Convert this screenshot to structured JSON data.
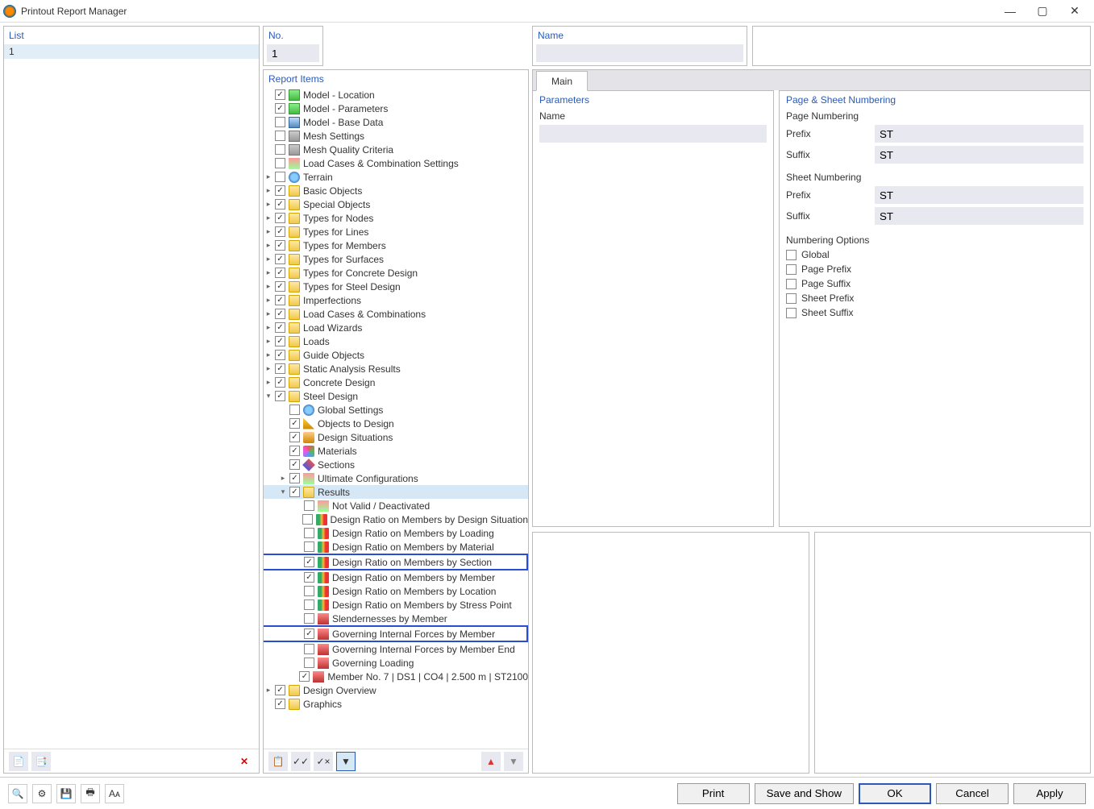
{
  "window": {
    "title": "Printout Report Manager"
  },
  "list": {
    "header": "List",
    "items": [
      "1"
    ]
  },
  "no": {
    "label": "No.",
    "value": "1"
  },
  "name": {
    "label": "Name",
    "value": ""
  },
  "report_header": "Report Items",
  "tree": [
    {
      "chev": "",
      "ind": 0,
      "chk": true,
      "icon": "ico-model",
      "label": "Model - Location"
    },
    {
      "chev": "",
      "ind": 0,
      "chk": true,
      "icon": "ico-model",
      "label": "Model - Parameters"
    },
    {
      "chev": "",
      "ind": 0,
      "chk": false,
      "icon": "ico-model2",
      "label": "Model - Base Data"
    },
    {
      "chev": "",
      "ind": 0,
      "chk": false,
      "icon": "ico-mesh",
      "label": "Mesh Settings"
    },
    {
      "chev": "",
      "ind": 0,
      "chk": false,
      "icon": "ico-mesh",
      "label": "Mesh Quality Criteria"
    },
    {
      "chev": "",
      "ind": 0,
      "chk": false,
      "icon": "ico-chart",
      "label": "Load Cases & Combination Settings"
    },
    {
      "chev": ">",
      "ind": 0,
      "chk": false,
      "icon": "ico-globe",
      "label": "Terrain"
    },
    {
      "chev": ">",
      "ind": 0,
      "chk": true,
      "icon": "ico-folder",
      "label": "Basic Objects"
    },
    {
      "chev": ">",
      "ind": 0,
      "chk": true,
      "icon": "ico-folder",
      "label": "Special Objects"
    },
    {
      "chev": ">",
      "ind": 0,
      "chk": true,
      "icon": "ico-folder",
      "label": "Types for Nodes"
    },
    {
      "chev": ">",
      "ind": 0,
      "chk": true,
      "icon": "ico-folder",
      "label": "Types for Lines"
    },
    {
      "chev": ">",
      "ind": 0,
      "chk": true,
      "icon": "ico-folder",
      "label": "Types for Members"
    },
    {
      "chev": ">",
      "ind": 0,
      "chk": true,
      "icon": "ico-folder",
      "label": "Types for Surfaces"
    },
    {
      "chev": ">",
      "ind": 0,
      "chk": true,
      "icon": "ico-folder",
      "label": "Types for Concrete Design"
    },
    {
      "chev": ">",
      "ind": 0,
      "chk": true,
      "icon": "ico-folder",
      "label": "Types for Steel Design"
    },
    {
      "chev": ">",
      "ind": 0,
      "chk": true,
      "icon": "ico-folder",
      "label": "Imperfections"
    },
    {
      "chev": ">",
      "ind": 0,
      "chk": true,
      "icon": "ico-folder",
      "label": "Load Cases & Combinations"
    },
    {
      "chev": ">",
      "ind": 0,
      "chk": true,
      "icon": "ico-folder",
      "label": "Load Wizards"
    },
    {
      "chev": ">",
      "ind": 0,
      "chk": true,
      "icon": "ico-folder",
      "label": "Loads"
    },
    {
      "chev": ">",
      "ind": 0,
      "chk": true,
      "icon": "ico-folder",
      "label": "Guide Objects"
    },
    {
      "chev": ">",
      "ind": 0,
      "chk": true,
      "icon": "ico-folder",
      "label": "Static Analysis Results"
    },
    {
      "chev": ">",
      "ind": 0,
      "chk": true,
      "icon": "ico-folder",
      "label": "Concrete Design"
    },
    {
      "chev": "v",
      "ind": 0,
      "chk": true,
      "icon": "ico-folder",
      "label": "Steel Design"
    },
    {
      "chev": "",
      "ind": 1,
      "chk": false,
      "icon": "ico-globe",
      "label": "Global Settings"
    },
    {
      "chev": "",
      "ind": 1,
      "chk": true,
      "icon": "ico-obj",
      "label": "Objects to Design"
    },
    {
      "chev": "",
      "ind": 1,
      "chk": true,
      "icon": "ico-wizard",
      "label": "Design Situations"
    },
    {
      "chev": "",
      "ind": 1,
      "chk": true,
      "icon": "ico-mat",
      "label": "Materials"
    },
    {
      "chev": "",
      "ind": 1,
      "chk": true,
      "icon": "ico-sec",
      "label": "Sections"
    },
    {
      "chev": ">",
      "ind": 1,
      "chk": true,
      "icon": "ico-chart",
      "label": "Ultimate Configurations"
    },
    {
      "chev": "v",
      "ind": 1,
      "chk": true,
      "icon": "ico-folder",
      "label": "Results",
      "sel": true
    },
    {
      "chev": "",
      "ind": 2,
      "chk": false,
      "icon": "ico-chart",
      "label": "Not Valid / Deactivated"
    },
    {
      "chev": "",
      "ind": 2,
      "chk": false,
      "icon": "ico-ratio",
      "label": "Design Ratio on Members by Design Situation"
    },
    {
      "chev": "",
      "ind": 2,
      "chk": false,
      "icon": "ico-ratio",
      "label": "Design Ratio on Members by Loading"
    },
    {
      "chev": "",
      "ind": 2,
      "chk": false,
      "icon": "ico-ratio",
      "label": "Design Ratio on Members by Material"
    },
    {
      "chev": "",
      "ind": 2,
      "chk": true,
      "icon": "ico-ratio",
      "label": "Design Ratio on Members by Section",
      "hl": true
    },
    {
      "chev": "",
      "ind": 2,
      "chk": true,
      "icon": "ico-ratio",
      "label": "Design Ratio on Members by Member"
    },
    {
      "chev": "",
      "ind": 2,
      "chk": false,
      "icon": "ico-ratio",
      "label": "Design Ratio on Members by Location"
    },
    {
      "chev": "",
      "ind": 2,
      "chk": false,
      "icon": "ico-ratio",
      "label": "Design Ratio on Members by Stress Point"
    },
    {
      "chev": "",
      "ind": 2,
      "chk": false,
      "icon": "ico-force",
      "label": "Slendernesses by Member"
    },
    {
      "chev": "",
      "ind": 2,
      "chk": true,
      "icon": "ico-force",
      "label": "Governing Internal Forces by Member",
      "hl": true
    },
    {
      "chev": "",
      "ind": 2,
      "chk": false,
      "icon": "ico-force",
      "label": "Governing Internal Forces by Member End"
    },
    {
      "chev": "",
      "ind": 2,
      "chk": false,
      "icon": "ico-force",
      "label": "Governing Loading"
    },
    {
      "chev": "",
      "ind": 2,
      "chk": true,
      "icon": "ico-force",
      "label": "Member No. 7 | DS1 | CO4 | 2.500 m | ST2100"
    },
    {
      "chev": ">",
      "ind": 0,
      "chk": true,
      "icon": "ico-folder",
      "label": "Design Overview"
    },
    {
      "chev": "",
      "ind": 0,
      "chk": true,
      "icon": "ico-folder",
      "label": "Graphics"
    }
  ],
  "tab": {
    "main": "Main"
  },
  "parameters": {
    "title": "Parameters",
    "name_label": "Name",
    "name_value": ""
  },
  "numbering": {
    "title": "Page & Sheet Numbering",
    "page_title": "Page Numbering",
    "sheet_title": "Sheet Numbering",
    "prefix_label": "Prefix",
    "suffix_label": "Suffix",
    "page_prefix": "ST",
    "page_suffix": "ST",
    "sheet_prefix": "ST",
    "sheet_suffix": "ST",
    "options_title": "Numbering Options",
    "options": [
      "Global",
      "Page Prefix",
      "Page Suffix",
      "Sheet Prefix",
      "Sheet Suffix"
    ]
  },
  "footer": {
    "print": "Print",
    "save_show": "Save and Show",
    "ok": "OK",
    "cancel": "Cancel",
    "apply": "Apply"
  }
}
